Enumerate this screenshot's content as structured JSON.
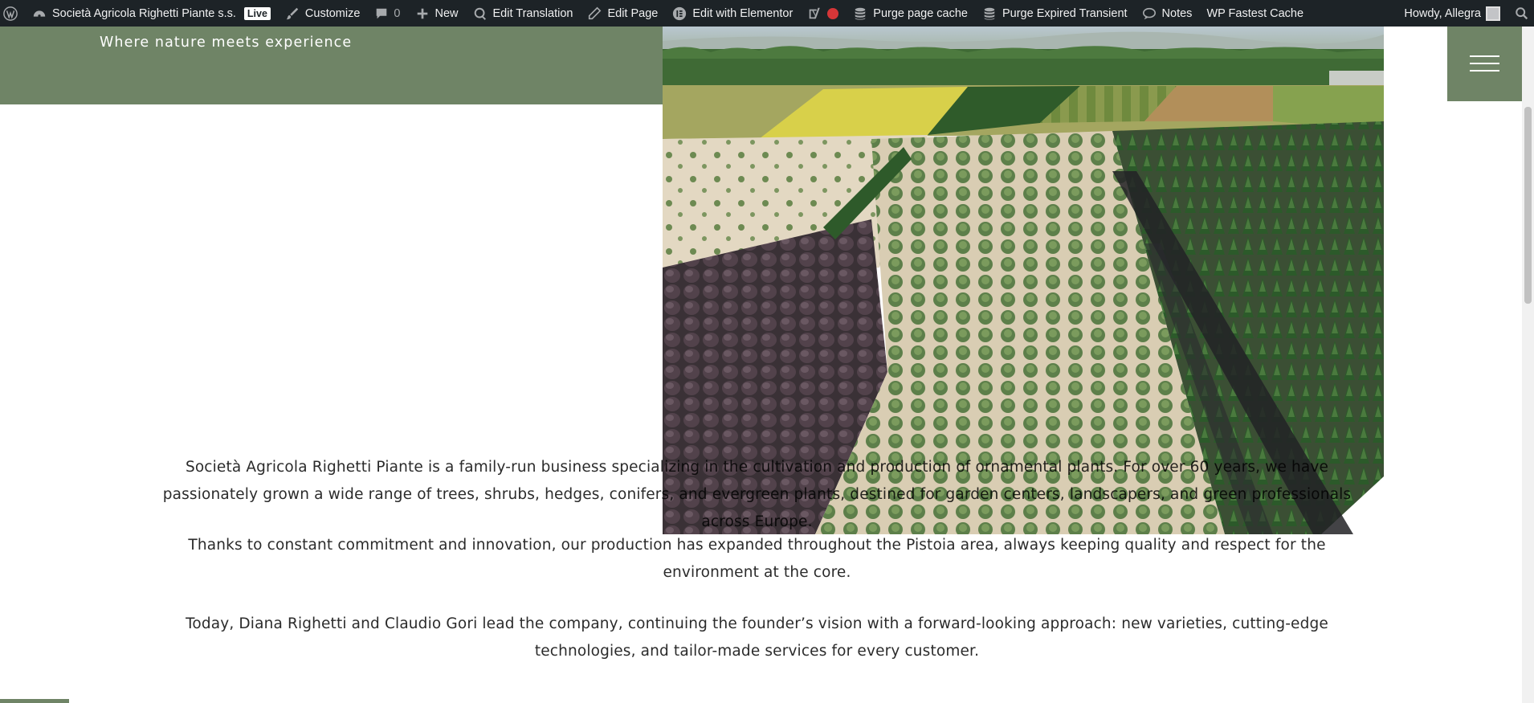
{
  "adminbar": {
    "site_name": "Società Agricola Righetti Piante s.s.",
    "live_badge": "Live",
    "customize": "Customize",
    "comments_count": "0",
    "new": "New",
    "edit_translation": "Edit Translation",
    "edit_page": "Edit Page",
    "edit_elementor": "Edit with Elementor",
    "purge_page_cache": "Purge page cache",
    "purge_expired_transient": "Purge Expired Transient",
    "notes": "Notes",
    "wp_fastest_cache": "WP Fastest Cache",
    "howdy": "Howdy, Allegra"
  },
  "header": {
    "tagline": "Where nature meets experience"
  },
  "content": {
    "paragraphs": [
      "Società Agricola Righetti Piante is a family-run business specializing in the cultivation and production of ornamental plants. For over 60 years, we have passionately grown a wide range of trees, shrubs, hedges, conifers, and evergreen plants, destined for garden centers, landscapers, and green professionals across Europe.",
      "Thanks to constant commitment and innovation, our production has expanded throughout the Pistoia area, always keeping quality and respect for the environment at the core.",
      "Today, Diana Righetti and Claudio Gori lead the company, continuing the founder’s vision with a forward-looking approach: new varieties, cutting-edge technologies, and tailor-made services for every customer."
    ]
  },
  "colors": {
    "brand_green": "#6f8466",
    "adminbar_bg": "#1d2327",
    "status_red": "#d63638"
  },
  "icons": {
    "wordpress": "wordpress-icon",
    "dashboard": "dashboard-icon",
    "customize": "paintbrush-icon",
    "comments": "comment-icon",
    "new": "plus-icon",
    "translate": "translate-icon",
    "edit": "pencil-icon",
    "elementor": "elementor-icon",
    "yoast": "yoast-icon",
    "database": "database-icon",
    "notes": "speech-bubble-icon",
    "search": "search-icon",
    "menu": "hamburger-icon"
  }
}
